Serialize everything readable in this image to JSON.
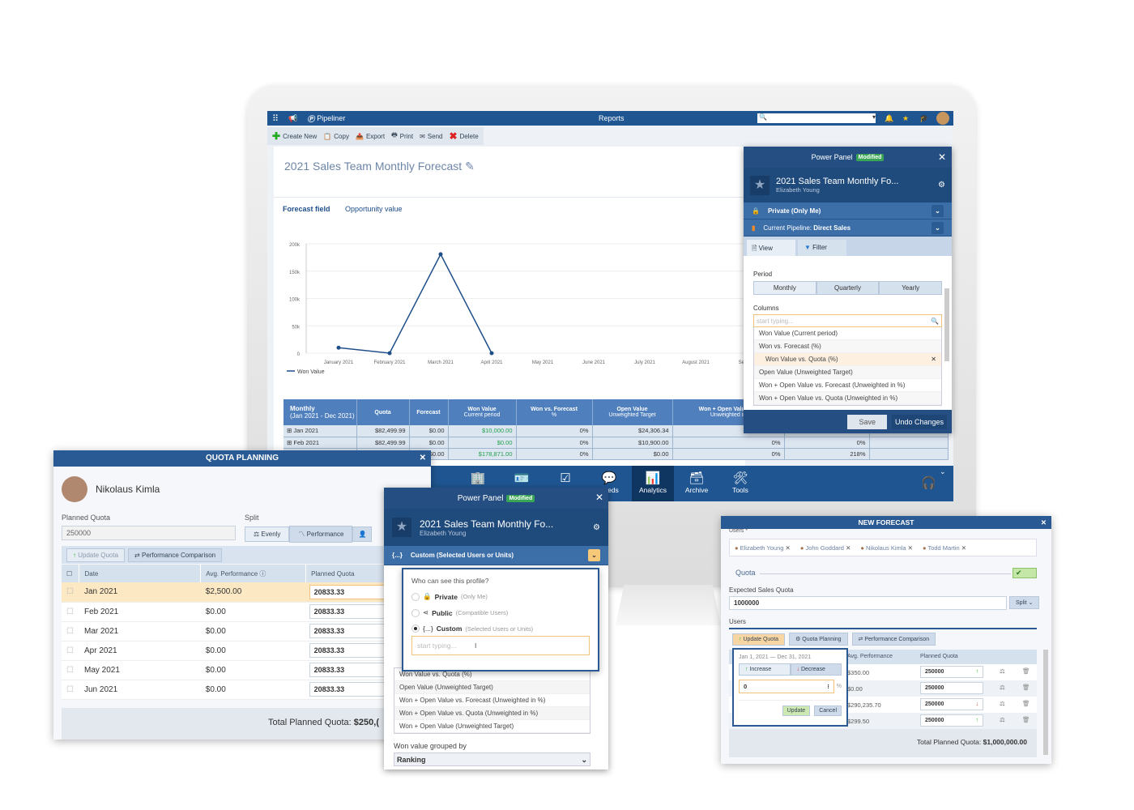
{
  "app": {
    "name": "Pipeliner",
    "section": "Reports",
    "search_placeholder": ""
  },
  "toolbar": {
    "create": "Create New",
    "copy": "Copy",
    "export": "Export",
    "print": "Print",
    "send": "Send",
    "delete": "Delete"
  },
  "report": {
    "title": "2021 Sales Team Monthly Forecast",
    "tab_active": "Forecast field",
    "tab_other": "Opportunity value"
  },
  "chart_data": {
    "type": "line",
    "categories": [
      "January 2021",
      "February 2021",
      "March 2021",
      "April 2021",
      "May 2021",
      "June 2021",
      "July 2021",
      "August 2021",
      "Septem"
    ],
    "series": [
      {
        "name": "Won Value",
        "values": [
          10000,
          0,
          180871,
          0,
          null,
          null,
          null,
          null,
          null
        ]
      }
    ],
    "yticks": [
      "0",
      "50k",
      "100k",
      "150k",
      "200k"
    ],
    "ylim": [
      0,
      200000
    ],
    "grid": true,
    "legend": "bottom-left",
    "color": "#1f4f8a"
  },
  "table": {
    "headers": [
      [
        "Monthly",
        "(Jan 2021 - Dec 2021)"
      ],
      [
        "Quota",
        ""
      ],
      [
        "Forecast",
        ""
      ],
      [
        "Won Value",
        "Current period"
      ],
      [
        "Won vs. Forecast",
        "%"
      ],
      [
        "Open Value",
        "Unweighted Target"
      ],
      [
        "Won + Open Value vs.",
        "Unweighted in"
      ],
      [
        "",
        ""
      ],
      [
        "",
        ""
      ]
    ],
    "rows": [
      [
        "Jan 2021",
        "$82,499.99",
        "$0.00",
        "$10,000.00",
        "0%",
        "$24,306.34",
        "0%",
        "12%",
        ""
      ],
      [
        "Feb 2021",
        "$82,499.99",
        "$0.00",
        "$0.00",
        "0%",
        "$10,900.00",
        "0%",
        "0%",
        ""
      ],
      [
        "",
        "",
        "$0.00",
        "$178,871.00",
        "0%",
        "$0.00",
        "0%",
        "218%",
        ""
      ]
    ]
  },
  "power_panel": {
    "title": "Power Panel",
    "badge": "Modified",
    "profile_title": "2021 Sales Team Monthly Fo...",
    "owner": "Elizabeth Young",
    "visibility": "Private",
    "visibility_note": "(Only Me)",
    "pipeline_label": "Current Pipeline:",
    "pipeline": "Direct Sales",
    "tabs": [
      "View",
      "Filter"
    ],
    "period_label": "Period",
    "periods": [
      "Monthly",
      "Quarterly",
      "Yearly"
    ],
    "period_selected": "Monthly",
    "columns_label": "Columns",
    "columns_placeholder": "start typing...",
    "columns": [
      "Won Value (Current period)",
      "Won vs. Forecast (%)",
      "Won Value vs. Quota (%)",
      "Open Value (Unweighted Target)",
      "Won + Open Value vs. Forecast (Unweighted in %)",
      "Won + Open Value vs. Quota (Unweighted in %)"
    ],
    "save": "Save",
    "undo": "Undo Changes"
  },
  "nav": {
    "items": [
      {
        "label": "",
        "icon": "building-icon"
      },
      {
        "label": "",
        "icon": "contact-card-icon"
      },
      {
        "label": "",
        "icon": "task-icon"
      },
      {
        "label": "Feeds",
        "icon": "feeds-icon"
      },
      {
        "label": "Analytics",
        "icon": "analytics-icon",
        "active": true
      },
      {
        "label": "Archive",
        "icon": "archive-icon"
      },
      {
        "label": "Tools",
        "icon": "tools-icon"
      }
    ]
  },
  "quota": {
    "title": "QUOTA PLANNING",
    "user": "Nikolaus Kimla",
    "planned_label": "Planned Quota",
    "planned_value": "250000",
    "split_label": "Split",
    "split": [
      "Evenly",
      "Performance"
    ],
    "update": "Update Quota",
    "compare": "Performance Comparison",
    "headers": [
      "Date",
      "Avg. Performance",
      "Planned Quota"
    ],
    "rows": [
      [
        "Jan 2021",
        "$2,500.00",
        "20833.33"
      ],
      [
        "Feb 2021",
        "$0.00",
        "20833.33"
      ],
      [
        "Mar 2021",
        "$0.00",
        "20833.33"
      ],
      [
        "Apr 2021",
        "$0.00",
        "20833.33"
      ],
      [
        "May 2021",
        "$0.00",
        "20833.33"
      ],
      [
        "Jun 2021",
        "$0.00",
        "20833.33"
      ]
    ],
    "total_label": "Total Planned Quota:",
    "total": "$250,("
  },
  "power_panel2": {
    "visibility": "Custom",
    "visibility_note": "(Selected Users or Units)",
    "question": "Who can see this profile?",
    "options": [
      {
        "label": "Private",
        "note": "(Only Me)"
      },
      {
        "label": "Public",
        "note": "(Compatible Users)"
      },
      {
        "label": "Custom",
        "note": "(Selected Users or Units)",
        "selected": true
      }
    ],
    "placeholder": "start typing...",
    "columns": [
      "Won Value vs. Quota (%)",
      "Open Value (Unweighted Target)",
      "Won + Open Value vs. Forecast (Unweighted in %)",
      "Won + Open Value vs. Quota (Unweighted in %)",
      "Won + Open Value (Unweighted Target)"
    ],
    "group_label": "Won value grouped by",
    "group_value": "Ranking"
  },
  "forecast": {
    "title": "NEW FORECAST",
    "users_label": "Users *",
    "users": [
      "Elizabeth Young",
      "John Goddard",
      "Nikolaus Kimla",
      "Todd Martin"
    ],
    "quota_label": "Quota",
    "expected_label": "Expected Sales Quota",
    "expected_value": "1000000",
    "split": "Split",
    "users2": "Users",
    "update": "Update Quota",
    "planning": "Quota Planning",
    "compare": "Performance Comparison",
    "headers": [
      "Avg. Performance",
      "Planned Quota"
    ],
    "rows": [
      [
        "$350.00",
        "250000",
        "up"
      ],
      [
        "$0.00",
        "250000",
        ""
      ],
      [
        "$290,235.70",
        "250000",
        "down"
      ],
      [
        "$299.50",
        "250000",
        "up"
      ]
    ],
    "popup": {
      "range": "Jan 1, 2021 — Dec 31, 2021",
      "increase": "Increase",
      "decrease": "Decrease",
      "value": "0",
      "unit": "%",
      "update": "Update",
      "cancel": "Cancel"
    },
    "total_label": "Total Planned Quota:",
    "total": "$1,000,000.00"
  }
}
